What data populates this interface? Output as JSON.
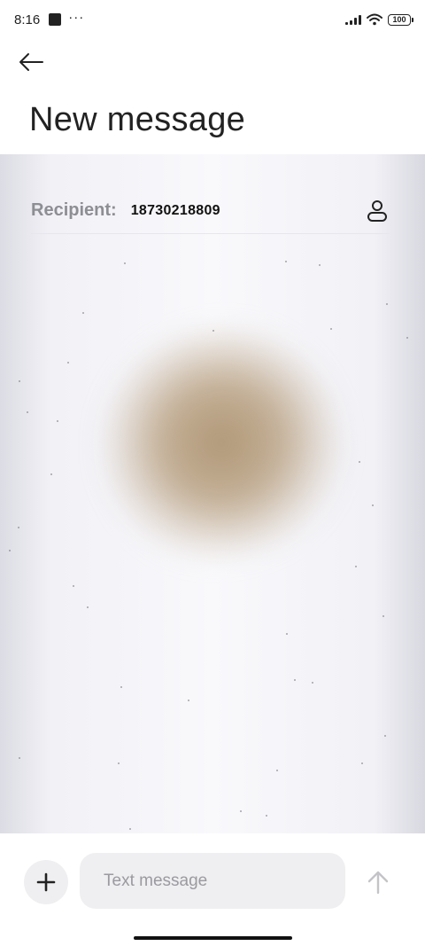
{
  "status_bar": {
    "time": "8:16",
    "more_indicator": "···",
    "battery_level": "100"
  },
  "header": {
    "back_icon": "arrow-left-icon",
    "title": "New message"
  },
  "recipient": {
    "label": "Recipient:",
    "value": "18730218809",
    "contact_icon": "contact-person-icon"
  },
  "composer": {
    "add_icon": "plus-icon",
    "placeholder": "Text message",
    "value": "",
    "send_icon": "arrow-up-icon"
  },
  "colors": {
    "title_text": "#222222",
    "label_gray": "#8d8d94",
    "input_bg": "#efeff1",
    "send_disabled": "#c4c4c8",
    "wallpaper_blob": "#ac916e"
  }
}
